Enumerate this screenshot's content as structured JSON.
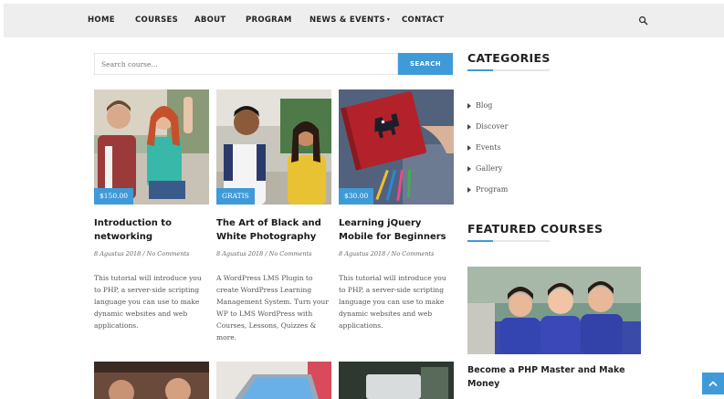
{
  "nav": {
    "items": [
      "HOME",
      "COURSES",
      "ABOUT",
      "PROGRAM",
      "NEWS & EVENTS",
      "CONTACT"
    ],
    "dropdown_caret": "▾",
    "search_icon": "search-icon"
  },
  "search": {
    "placeholder": "Search course...",
    "button_label": "SEARCH"
  },
  "courses": [
    {
      "title": "Introduction to networking",
      "price": "$150.00",
      "meta": "8 Agustus 2018 / No Comments",
      "excerpt": "This tutorial will introduce you to PHP, a server-side scripting language you can use to make dynamic websites and web applications."
    },
    {
      "title": "The Art of Black and White Photography",
      "price": "GRATIS",
      "meta": "8 Agustus 2018 / No Comments",
      "excerpt": "A WordPress LMS Plugin to create WordPress Learning Management System. Turn your WP to LMS WordPress with Courses, Lessons, Quizzes & more."
    },
    {
      "title": "Learning jQuery Mobile for Beginners",
      "price": "$30.00",
      "meta": "8 Agustus 2018 / No Comments",
      "excerpt": "This tutorial will introduce you to PHP, a server-side scripting language you can use to make dynamic websites and web applications."
    }
  ],
  "sidebar": {
    "categories_heading": "CATEGORIES",
    "categories": [
      "Blog",
      "Discover",
      "Events",
      "Gallery",
      "Program"
    ],
    "featured_heading": "FEATURED COURSES",
    "featured_title": "Become a PHP Master and Make Money"
  },
  "colors": {
    "accent": "#3f9ad8",
    "nav_bg": "#eeeeee"
  }
}
